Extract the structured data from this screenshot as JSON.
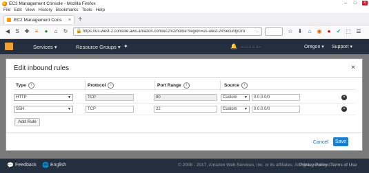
{
  "window": {
    "title": "EC2 Management Console - Mozilla Firefox",
    "minimize_icon": "minimize-icon",
    "maximize_icon": "maximize-icon",
    "close_icon": "close-icon"
  },
  "menu": [
    "File",
    "Edit",
    "View",
    "History",
    "Bookmarks",
    "Tools",
    "Help"
  ],
  "tab": {
    "label": "EC2 Management Cons",
    "close": "×",
    "new_tab": "+"
  },
  "url": {
    "text": "https://us-west-2.console.aws.amazon.com/ec2/v2/home?region=us-west-2#SecurityGro",
    "end": "..."
  },
  "aws": {
    "services": "Services ▾",
    "resource_groups": "Resource Groups ▾",
    "pin": "✦",
    "account": "...............",
    "region": "Oregon ▾",
    "support": "Support ▾",
    "accent": "#f0a230"
  },
  "modal": {
    "title": "Edit inbound rules",
    "close": "×",
    "columns": [
      "Type",
      "Protocol",
      "Port Range",
      "Source"
    ],
    "rules": [
      {
        "type": "HTTP",
        "protocol": "TCP",
        "port": "80",
        "source_mode": "Custom",
        "source": "0.0.0.0/0"
      },
      {
        "type": "SSH",
        "protocol": "TCP",
        "port": "22",
        "source_mode": "Custom",
        "source": "0.0.0.0/0"
      }
    ],
    "add_rule": "Add Rule",
    "cancel": "Cancel",
    "save": "Save"
  },
  "footer": {
    "feedback": "Feedback",
    "language": "English",
    "copyright": "© 2008 - 2017, Amazon Web Services, Inc. or its affiliates. All rights reserved.",
    "privacy": "Privacy Policy",
    "terms": "Terms of Use"
  }
}
